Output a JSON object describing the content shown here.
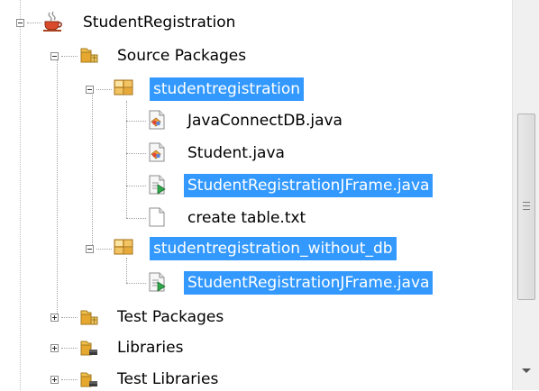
{
  "tree": {
    "root": {
      "label": "StudentRegistration",
      "icon": "java-project-icon"
    },
    "source_packages": {
      "label": "Source Packages",
      "icon": "source-packages-folder-icon"
    },
    "package_studentregistration": {
      "label": "studentregistration",
      "icon": "java-package-icon",
      "files": [
        {
          "label": "JavaConnectDB.java",
          "icon": "java-class-icon"
        },
        {
          "label": "Student.java",
          "icon": "java-class-icon"
        },
        {
          "label": "StudentRegistrationJFrame.java",
          "icon": "jframe-form-icon"
        },
        {
          "label": "create table.txt",
          "icon": "text-file-icon"
        }
      ]
    },
    "package_without_db": {
      "label": "studentregistration_without_db",
      "icon": "java-package-icon",
      "files": [
        {
          "label": "StudentRegistrationJFrame.java",
          "icon": "jframe-form-icon"
        }
      ]
    },
    "test_packages": {
      "label": "Test Packages",
      "icon": "test-packages-folder-icon"
    },
    "libraries": {
      "label": "Libraries",
      "icon": "libraries-folder-icon"
    },
    "test_libraries": {
      "label": "Test Libraries",
      "icon": "test-libraries-folder-icon"
    }
  },
  "colors": {
    "selection": "#3399ff",
    "selection_text": "#ffffff",
    "folder": "#e8b64b",
    "package": "#e7a331"
  }
}
